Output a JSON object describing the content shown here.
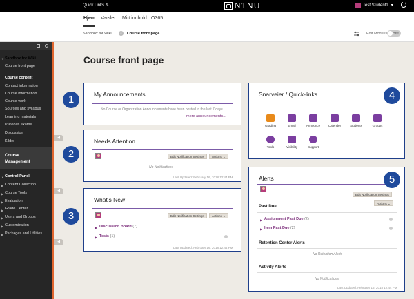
{
  "topbar": {
    "quick_links": "Quick Links",
    "logo_text": "NTNU",
    "user_name": "Test Student1"
  },
  "nav": {
    "tabs": [
      {
        "label": "Hjem",
        "active": true
      },
      {
        "label": "Varsler"
      },
      {
        "label": "Mitt innhold"
      },
      {
        "label": "O365"
      }
    ]
  },
  "breadcrumb": {
    "items": [
      "Sandbox for Wiki",
      "Course front page"
    ]
  },
  "edit_mode": {
    "label": "Edit Mode is:",
    "state": "OFF"
  },
  "sidebar": {
    "course_title": "Sandbox for Wiki",
    "front_page": "Course front page",
    "items": [
      {
        "label": "Course content",
        "bold": true
      },
      {
        "label": "Contact information"
      },
      {
        "label": "Course information"
      },
      {
        "label": "Course work"
      },
      {
        "label": "Sources and syllabus"
      },
      {
        "label": "Learning materials"
      },
      {
        "label": "Previous exams"
      },
      {
        "label": "Discussion"
      },
      {
        "label": "Kilder"
      }
    ],
    "management": {
      "title_line1": "Course",
      "title_line2": "Management",
      "control_panel": "Control Panel",
      "panel_items": [
        "Content Collection",
        "Course Tools",
        "Evaluation",
        "Grade Center",
        "Users and Groups",
        "Customization",
        "Packages and Utilities"
      ]
    }
  },
  "main": {
    "page_title": "Course front page",
    "announcements": {
      "title": "My Announcements",
      "empty_text": "No Course or Organization Announcements have been posted in the last 7 days.",
      "more_link": "more announcements..."
    },
    "needs_attention": {
      "title": "Needs Attention",
      "edit_btn": "Edit Notification Settings",
      "actions_btn": "Actions",
      "empty_text": "No Notifications",
      "updated": "Last Updated: February 16, 2018 12:44 PM"
    },
    "whats_new": {
      "title": "What's New",
      "edit_btn": "Edit Notification Settings",
      "actions_btn": "Actions",
      "rows": [
        {
          "label": "Discussion Board",
          "count": "(7)"
        },
        {
          "label": "Tests",
          "count": "(1)"
        }
      ],
      "updated": "Last Updated: February 16, 2018 12:44 PM"
    },
    "quicklinks": {
      "title": "Snarveier / Quick-links",
      "tiles": [
        {
          "label": "Grading",
          "icon": "grading-icon",
          "color": "#e88a1a"
        },
        {
          "label": "Email",
          "icon": "email-icon",
          "color": "#7b3ea0"
        },
        {
          "label": "Announce",
          "icon": "megaphone-icon",
          "color": "#7b3ea0"
        },
        {
          "label": "Calender",
          "icon": "calendar-icon",
          "color": "#7b3ea0"
        },
        {
          "label": "Students",
          "icon": "students-icon",
          "color": "#7b3ea0"
        },
        {
          "label": "Groups",
          "icon": "groups-icon",
          "color": "#7b3ea0"
        },
        {
          "label": "Tools",
          "icon": "tools-icon",
          "color": "#7b3ea0"
        },
        {
          "label": "Visibility",
          "icon": "visibility-icon",
          "color": "#7b3ea0"
        },
        {
          "label": "Support",
          "icon": "support-icon",
          "color": "#7b3ea0"
        }
      ]
    },
    "alerts": {
      "title": "Alerts",
      "edit_btn": "Edit Notification Settings",
      "actions_btn": "Actions",
      "past_due_heading": "Past Due",
      "past_due_rows": [
        {
          "label": "Assignment Past Due",
          "count": "(2)"
        },
        {
          "label": "Item Past Due",
          "count": "(2)"
        }
      ],
      "retention_heading": "Retention Center Alerts",
      "retention_empty": "No Retention Alerts",
      "activity_heading": "Activity Alerts",
      "activity_empty": "No Notifications",
      "updated": "Last Updated: February 16, 2018 12:44 PM"
    },
    "badges": [
      "1",
      "2",
      "3",
      "4",
      "5"
    ]
  },
  "colors": {
    "accent_orange": "#e0662f",
    "module_border": "#1f3f8a",
    "badge_blue": "#1f4a9c",
    "link_purple": "#7b2c7a"
  }
}
